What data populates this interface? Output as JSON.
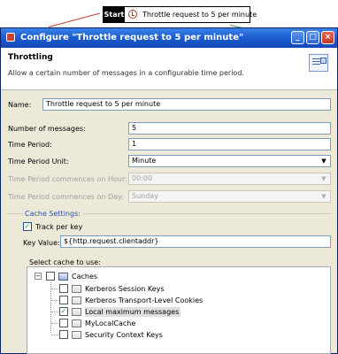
{
  "canvas": {
    "start_label": "Start",
    "node_label": "Throttle request to 5 per minute",
    "node_icon": "throttle-icon"
  },
  "window": {
    "title": "Configure \"Throttle request to 5 per minute\"",
    "controls": {
      "minimize": "_",
      "maximize": "□",
      "close": "×"
    }
  },
  "header": {
    "title": "Throttling",
    "description": "Allow a certain number of messages in a configurable time period.",
    "icon": "filter-settings-icon"
  },
  "form": {
    "name": {
      "label": "Name:",
      "value": "Throttle request to 5 per minute"
    },
    "messages": {
      "label": "Number of messages:",
      "value": "5"
    },
    "period": {
      "label": "Time Period:",
      "value": "1"
    },
    "unit": {
      "label": "Time Period Unit:",
      "value": "Minute"
    },
    "on_hour": {
      "label": "Time Period commences on Hour:",
      "value": "00:00"
    },
    "on_day": {
      "label": "Time Period commences on Day:",
      "value": "Sunday"
    }
  },
  "cache_settings": {
    "title": "Cache Settings:",
    "track_per_key": {
      "label": "Track per key",
      "checked": true
    },
    "key_value": {
      "label": "Key Value:",
      "value": "${http.request.clientaddr}"
    },
    "select_label": "Select cache to use:",
    "root": {
      "label": "Caches",
      "checked": false
    },
    "items": [
      {
        "label": "Kerberos Session Keys",
        "checked": false
      },
      {
        "label": "Kerberos Transport-Level Cookies",
        "checked": false
      },
      {
        "label": "Local maximum messages",
        "checked": true
      },
      {
        "label": "MyLocalCache",
        "checked": false
      },
      {
        "label": "Security Context Keys",
        "checked": false
      }
    ]
  },
  "colors": {
    "title_bar": "#1d5ed1",
    "group_title": "#2a4fb4",
    "check_mark": "#21a121"
  }
}
